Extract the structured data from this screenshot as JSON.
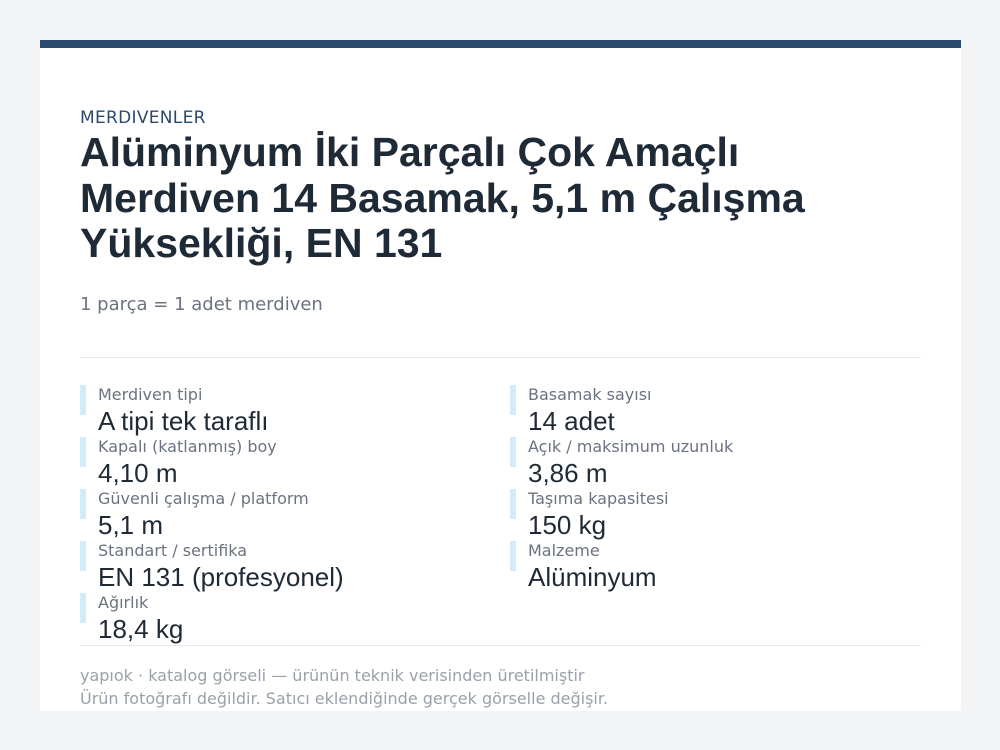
{
  "header": {
    "category": "MERDIVENLER",
    "title": "Alüminyum İki Parçalı Çok Amaçlı Merdiven 14 Basamak, 5,1 m Çalışma Yüksekliği, EN 131",
    "subtitle": "1 parça = 1 adet merdiven"
  },
  "specs": {
    "left": [
      {
        "label": "Merdiven tipi",
        "value": "A tipi tek taraflı"
      },
      {
        "label": "Kapalı (katlanmış) boy",
        "value": "4,10 m"
      },
      {
        "label": "Güvenli çalışma / platform",
        "value": "5,1 m"
      },
      {
        "label": "Standart / sertifika",
        "value": "EN 131 (profesyonel)"
      },
      {
        "label": "Ağırlık",
        "value": "18,4 kg"
      }
    ],
    "right": [
      {
        "label": "Basamak sayısı",
        "value": "14 adet"
      },
      {
        "label": "Açık / maksimum uzunluk",
        "value": "3,86 m"
      },
      {
        "label": "Taşıma kapasitesi",
        "value": "150 kg"
      },
      {
        "label": "Malzeme",
        "value": "Alüminyum"
      }
    ]
  },
  "footer": {
    "source": "yapıok · katalog görseli — ürünün teknik verisinden üretilmiştir",
    "note": "Ürün fotoğrafı değildir. Satıcı eklendiğinde gerçek görselle değişir."
  },
  "colors": {
    "accent": "#2c4a6b",
    "spec_bar": "#d3ecfa",
    "text": "#1f2a37",
    "muted": "#6b7280"
  }
}
